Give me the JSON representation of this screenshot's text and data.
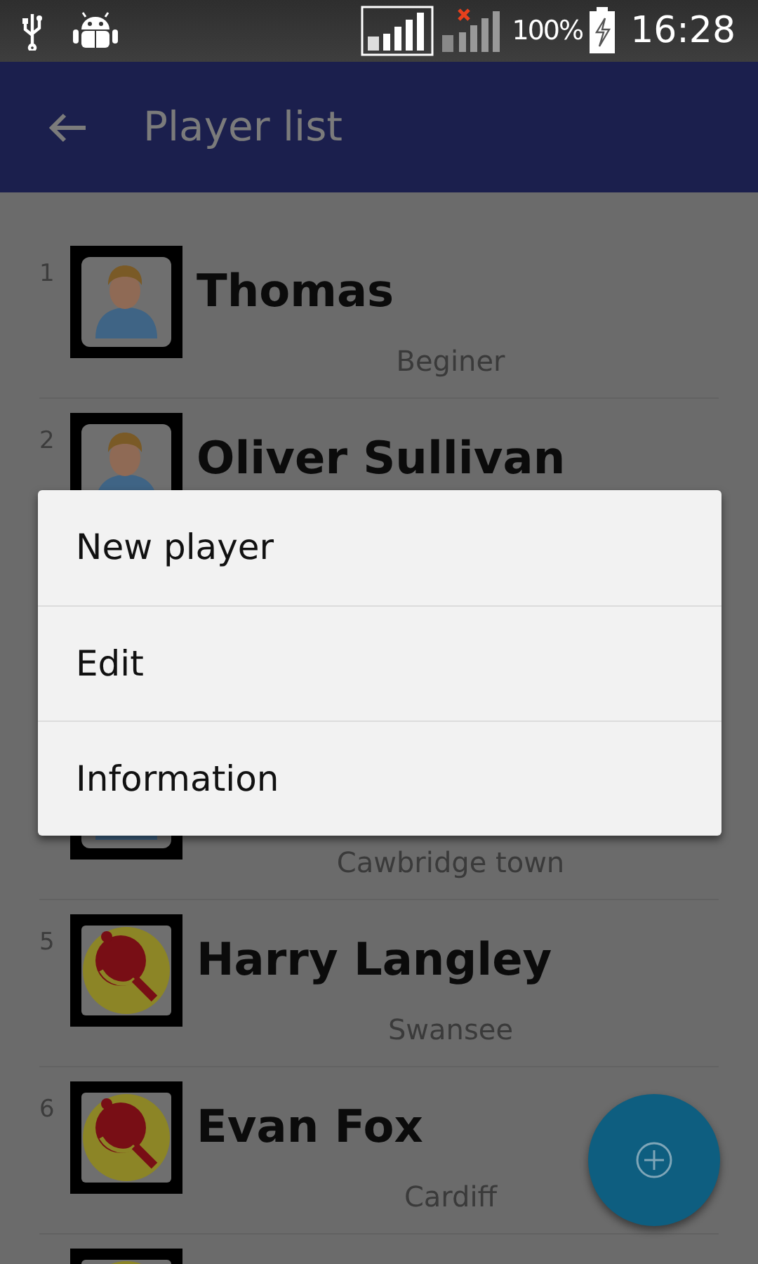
{
  "status_bar": {
    "battery": "100%",
    "time": "16:28"
  },
  "app_bar": {
    "title": "Player list"
  },
  "players": [
    {
      "number": "1",
      "name": "Thomas",
      "subtitle": "Beginer",
      "kind": "person"
    },
    {
      "number": "2",
      "name": "Oliver Sullivan",
      "kind": "person"
    },
    {
      "kind": "covered"
    },
    {
      "subtitle": "Cawbridge town",
      "kind": "person"
    },
    {
      "number": "5",
      "name": "Harry Langley",
      "subtitle": "Swansee",
      "kind": "racket"
    },
    {
      "number": "6",
      "name": "Evan Fox",
      "subtitle": "Cardiff",
      "kind": "racket"
    },
    {
      "kind": "racket"
    }
  ],
  "context_menu": {
    "items": [
      "New player",
      "Edit",
      "Information"
    ]
  }
}
